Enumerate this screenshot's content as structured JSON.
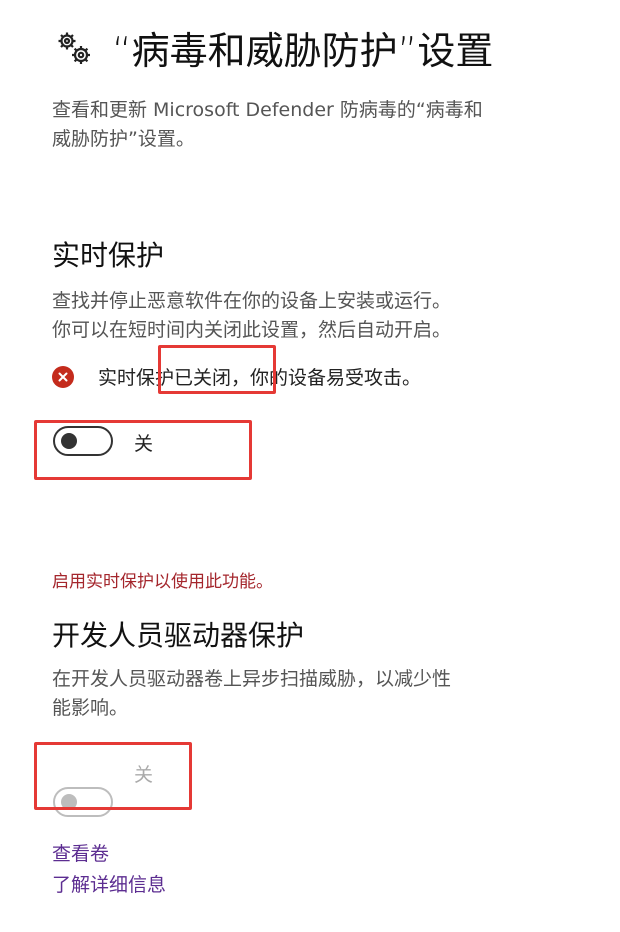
{
  "header": {
    "title": "“病毒和威胁防护”设置",
    "icon": "gear-icon",
    "description_line1": "查看和更新 Microsoft Defender 防病毒的“病毒和",
    "description_line2": "威胁防护”设置。"
  },
  "realtime": {
    "heading": "实时保护",
    "desc_line1": "查找并停止恶意软件在你的设备上安装或运行。",
    "desc_line2": "你可以在短时间内关闭此设置，然后自动开启。",
    "status_text": "实时保护已关闭，你的设备易受攻击。",
    "status_icon": "error-icon",
    "toggle_state": "关",
    "toggle_on": false
  },
  "devdrive": {
    "warning": "启用实时保护以使用此功能。",
    "heading": "开发人员驱动器保护",
    "desc_line1": "在开发人员驱动器卷上异步扫描威胁，以减少性",
    "desc_line2": "能影响。",
    "toggle_state": "关",
    "toggle_on": false,
    "toggle_disabled": true
  },
  "links": {
    "view_volumes": "查看卷",
    "learn_more": "了解详细信息"
  },
  "colors": {
    "error": "#c42b1c",
    "warning_text": "#a4262c",
    "link": "#5c2d91",
    "highlight_box": "#e53935"
  }
}
